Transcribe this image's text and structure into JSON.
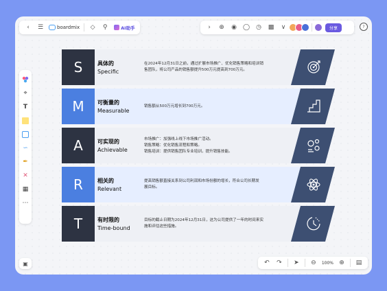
{
  "app": {
    "brand": "boardmix",
    "ai_label": "AI助手",
    "share_label": "分享",
    "zoom": "100%",
    "help": "?"
  },
  "colors": {
    "background": "#7b97f3",
    "dark": "#2d3342",
    "blue": "#4b7fe0",
    "shape": "#3d4f72",
    "row_light": "#eef0f5",
    "row_blue": "#e6eeff"
  },
  "smart": [
    {
      "letter": "S",
      "zh": "具体的",
      "en": "Specific",
      "lines": [
        "在2024年12月31日之前，通过扩展市场推广、优化销售策略和培训销",
        "售团队，将公司产品的销售额提升500万元提高到700万元。"
      ],
      "icon": "target-icon",
      "variant": "dark"
    },
    {
      "letter": "M",
      "zh": "可衡量的",
      "en": "Measurable",
      "lines": [
        "销售额从500万元增长到700万元。"
      ],
      "icon": "stairs-icon",
      "variant": "blue"
    },
    {
      "letter": "A",
      "zh": "可实现的",
      "en": "Achievable",
      "lines": [
        "市场推广：加强线上线下市场推广活动。",
        "销售策略：优化销售流程和策略。",
        "销售培训：提供销售团队专业培训，提升销售技能。"
      ],
      "icon": "settings-icon",
      "variant": "dark"
    },
    {
      "letter": "R",
      "zh": "相关的",
      "en": "Relevant",
      "lines": [
        "提高销售额直接关系到公司利润和市场份额的增长，符合公司长期发",
        "展目标。"
      ],
      "icon": "atom-icon",
      "variant": "blue"
    },
    {
      "letter": "T",
      "zh": "有时限的",
      "en": "Time-bound",
      "lines": [
        "目标的截止日期为2024年12月31日，这为公司提供了一年的时间来实",
        "施和评估这些措施。"
      ],
      "icon": "clock-icon",
      "variant": "dark"
    }
  ]
}
